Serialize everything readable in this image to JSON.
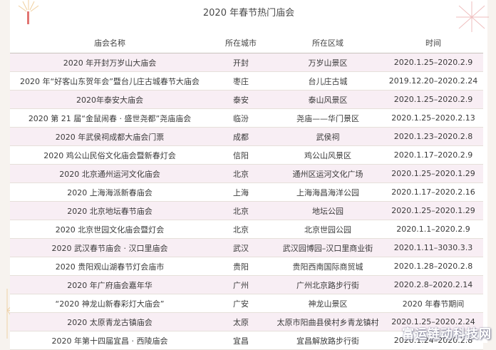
{
  "title": "2020 年春节热门庙会",
  "table": {
    "headers": [
      "庙会名称",
      "所在城市",
      "所在区域",
      "时间"
    ],
    "rows": [
      [
        "2020 年开封万岁山大庙会",
        "开封",
        "万岁山景区",
        "2020.1.25–2020.2.9"
      ],
      [
        "2020 年“好客山东贺年会”暨台儿庄古城春节大庙会",
        "枣庄",
        "台儿庄古城",
        "2019.12.20–2020.2.24"
      ],
      [
        "2020年泰安大庙会",
        "泰安",
        "泰山风景区",
        "2020.1.25–2020.2.9"
      ],
      [
        "2020 第 21 届“金鼠闹春 · 盛世尧都”尧庙庙会",
        "临汾",
        "尧庙——华门景区",
        "2020.1.25–2020.2.13"
      ],
      [
        "2020 年武侯祠成都大庙会门票",
        "成都",
        "武侯祠",
        "2020.1.23–2020.2.8"
      ],
      [
        "2020 鸡公山民俗文化庙会暨新春灯会",
        "信阳",
        "鸡公山风景区",
        "2020.1.17–2020.2.9"
      ],
      [
        "2020 北京通州运河文化庙会",
        "北京",
        "通州区运河文化广场",
        "2020.1.25–2020.1.29"
      ],
      [
        "2020 上海海派新春庙会",
        "上海",
        "上海海昌海洋公园",
        "2020.1.17–2020.2.16"
      ],
      [
        "2020 北京地坛春节庙会",
        "北京",
        "地坛公园",
        "2020.1.25–2020.1.29"
      ],
      [
        "2020 北京世园文化庙会暨灯会",
        "北京",
        "北京世园公园",
        "2020.1.1–2020.2.9"
      ],
      [
        "2020 武汉春节庙会 · 汉口里庙会",
        "武汉",
        "武汉园博园–汉口里商业街",
        "2020.1.11–3030.3.3"
      ],
      [
        "2020 贵阳观山湖春节灯会庙市",
        "贵阳",
        "贵阳西南国际商贸城",
        "2020.1.28–2020.2.8"
      ],
      [
        "2020 年广府庙会嘉年华",
        "广州",
        "广州北京路步行街",
        "2020.2.8–2020.2.14"
      ],
      [
        "“2020 神龙山新春彩灯大庙会”",
        "广安",
        "神龙山景区",
        "2020 年春节期间"
      ],
      [
        "2020 太原青龙古镇庙会",
        "太原",
        "太原市阳曲县侯村乡青龙镇村",
        "2020.1.25–2020.2.24"
      ],
      [
        "2020 年第十四届宜昌 · 西陵庙会",
        "宜昌",
        "宜昌解放路步行街",
        "2020.1.24–2020.2.8"
      ]
    ]
  },
  "watermark": "富运链动科技网",
  "colors": {
    "row_tint": "#f8eef4",
    "decoration_red": "#d9534f",
    "decoration_gold": "#e4a84f"
  }
}
